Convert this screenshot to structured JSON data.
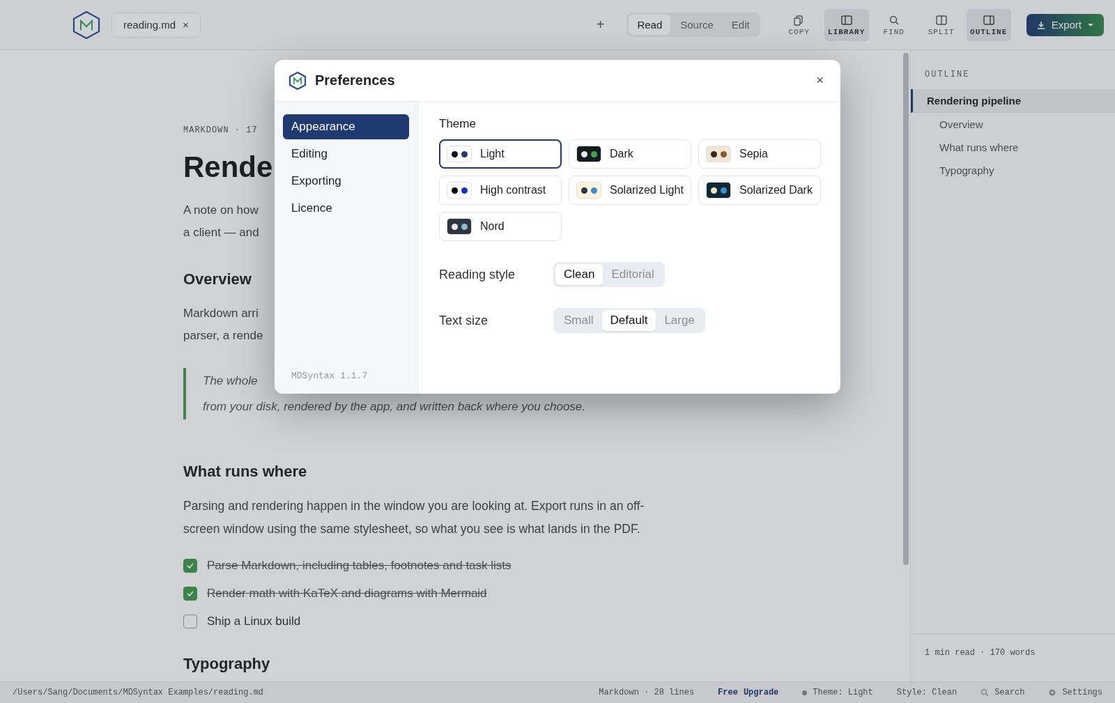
{
  "toolbar": {
    "file_tab": {
      "label": "reading.md",
      "close": "×"
    },
    "new_tab": "+",
    "view_modes": [
      {
        "label": "Read",
        "selected": true
      },
      {
        "label": "Source",
        "selected": false
      },
      {
        "label": "Edit",
        "selected": false
      }
    ],
    "tools": [
      {
        "kind": "copy",
        "label": "COPY",
        "selected": false
      },
      {
        "kind": "library",
        "label": "LIBRARY",
        "selected": true
      },
      {
        "kind": "find",
        "label": "FIND",
        "selected": false
      },
      {
        "kind": "split",
        "label": "SPLIT",
        "selected": false
      },
      {
        "kind": "outline",
        "label": "OUTLINE",
        "selected": true
      }
    ],
    "export": {
      "label": "Export"
    }
  },
  "document": {
    "blocks": [
      {
        "kind": "meta",
        "text": "MARKDOWN · 17"
      },
      {
        "kind": "title",
        "text": "Rende"
      },
      {
        "kind": "lines",
        "lines": [
          "A note on how",
          "a client — and"
        ]
      },
      {
        "kind": "heading",
        "text": "Overview"
      },
      {
        "kind": "lines",
        "lines": [
          "Markdown arri",
          "parser, a rende"
        ]
      },
      {
        "kind": "quote",
        "lines": [
          "The whole",
          "from your disk, rendered by the app, and written back where you choose."
        ]
      },
      {
        "kind": "heading",
        "text": "What runs where"
      },
      {
        "kind": "paragraph",
        "text": "Parsing and rendering happen in the window you are looking at. Export runs in an off-screen window using the same stylesheet, so what you see is what lands in the PDF."
      },
      {
        "kind": "tasks",
        "items": [
          {
            "text": "Parse Markdown, including tables, footnotes and task lists",
            "checked": true
          },
          {
            "text": "Render math with KaTeX and diagrams with Mermaid",
            "checked": true
          },
          {
            "text": "Ship a Linux build",
            "checked": false
          }
        ]
      },
      {
        "kind": "heading",
        "text": "Typography"
      }
    ]
  },
  "outline": {
    "title": "OUTLINE",
    "items": [
      {
        "label": "Rendering pipeline",
        "selected": true,
        "children": [
          {
            "label": "Overview",
            "selected": false
          },
          {
            "label": "What runs where",
            "selected": false
          },
          {
            "label": "Typography",
            "selected": false
          }
        ]
      }
    ],
    "footer": "1 min read · 170 words"
  },
  "status_bar": {
    "path": "/Users/Sang/Documents/MDSyntax Examples/reading.md",
    "format": "Markdown · 28 lines",
    "plan": "Free",
    "upgrade": "Upgrade",
    "theme": "Theme: Light",
    "style": "Style: Clean",
    "search": "Search",
    "settings": "Settings"
  },
  "dialog": {
    "title": "Preferences",
    "close": "×",
    "nav": [
      {
        "label": "Appearance",
        "selected": true
      },
      {
        "label": "Editing",
        "selected": false
      },
      {
        "label": "Exporting",
        "selected": false
      },
      {
        "label": "Licence",
        "selected": false
      }
    ],
    "version": "MDSyntax 1.1.7",
    "theme_label": "Theme",
    "themes": [
      {
        "label": "Light",
        "selected": true,
        "color": "#ffffff",
        "dots": [
          {
            "color": "#111111"
          },
          {
            "color": "#1e3a70"
          }
        ]
      },
      {
        "label": "Dark",
        "selected": false,
        "color": "#16191d",
        "dots": [
          {
            "color": "#e8e8e8"
          },
          {
            "color": "#3fa34d"
          }
        ]
      },
      {
        "label": "Sepia",
        "selected": false,
        "color": "#f1e6d6",
        "dots": [
          {
            "color": "#3b2a1c"
          },
          {
            "color": "#8a5a2b"
          }
        ]
      },
      {
        "label": "High contrast",
        "selected": false,
        "color": "#ffffff",
        "dots": [
          {
            "color": "#000000"
          },
          {
            "color": "#1530d0"
          }
        ]
      },
      {
        "label": "Solarized Light",
        "selected": false,
        "color": "#fdf5dc",
        "dots": [
          {
            "color": "#1f3b44"
          },
          {
            "color": "#3d8bd0"
          }
        ]
      },
      {
        "label": "Solarized Dark",
        "selected": false,
        "color": "#0d2a33",
        "dots": [
          {
            "color": "#f2e6c8"
          },
          {
            "color": "#3b8fd6"
          }
        ]
      },
      {
        "label": "Nord",
        "selected": false,
        "color": "#2e3440",
        "dots": [
          {
            "color": "#eceff4"
          },
          {
            "color": "#88c0d0"
          }
        ]
      }
    ],
    "settings": [
      {
        "label": "Reading style",
        "options": [
          {
            "label": "Clean",
            "selected": true
          },
          {
            "label": "Editorial",
            "selected": false
          }
        ]
      },
      {
        "label": "Text size",
        "options": [
          {
            "label": "Small",
            "selected": false
          },
          {
            "label": "Default",
            "selected": true
          },
          {
            "label": "Large",
            "selected": false
          }
        ]
      }
    ]
  }
}
